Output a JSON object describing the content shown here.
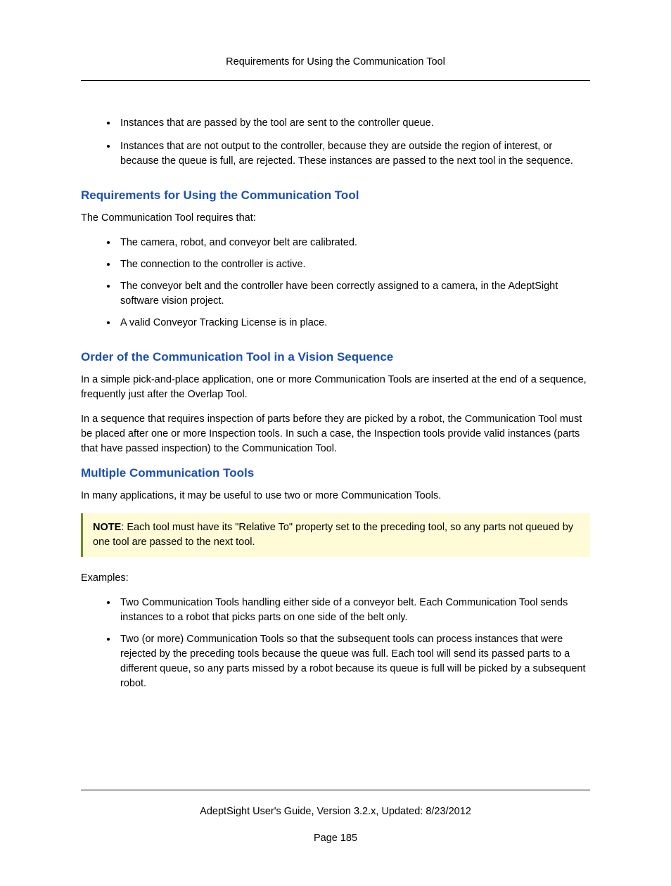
{
  "header": {
    "title": "Requirements for Using the Communication Tool"
  },
  "intro_bullets": [
    "Instances that are passed by the tool are sent to the controller queue.",
    "Instances that are not output to the controller, because they are outside the region of interest, or because the queue is full, are rejected. These instances are passed to the next tool in the sequence."
  ],
  "sections": {
    "requirements": {
      "heading": "Requirements for Using the Communication Tool",
      "lead": "The Communication Tool requires that:",
      "bullets": [
        "The camera, robot, and conveyor belt are calibrated.",
        "The connection to the controller is active.",
        "The conveyor belt and the controller have been correctly assigned to a camera, in the AdeptSight software vision project.",
        "A valid Conveyor Tracking License is in place."
      ]
    },
    "order": {
      "heading": "Order of the Communication Tool in a Vision Sequence",
      "p1": "In a simple pick-and-place application, one or more Communication Tools are inserted at the end of a sequence, frequently just after the Overlap Tool.",
      "p2": "In a sequence that requires inspection of parts before they are picked by a robot, the Communication Tool must be placed after one or more Inspection tools. In such a case, the Inspection tools provide valid instances (parts that have passed inspection) to the Communication Tool."
    },
    "multiple": {
      "heading": "Multiple Communication Tools",
      "lead": "In many applications, it may be useful to use two or more Communication Tools.",
      "note_label": "NOTE",
      "note_text": ": Each tool must have its \"Relative To\" property set to the preceding tool, so any parts not queued by one tool are passed to the next tool.",
      "examples_label": "Examples:",
      "bullets": [
        "Two Communication Tools handling either side of a conveyor belt. Each Communication Tool sends instances to a robot that picks parts on one side of the belt only.",
        "Two (or more) Communication Tools so that the subsequent tools can process instances that were rejected by the preceding tools because the queue was full. Each tool will send its passed parts to a different queue, so any parts missed by a robot because its queue is full will be picked by a subsequent robot."
      ]
    }
  },
  "footer": {
    "guide": "AdeptSight User's Guide,  Version 3.2.x, Updated: 8/23/2012",
    "page": "Page 185"
  }
}
